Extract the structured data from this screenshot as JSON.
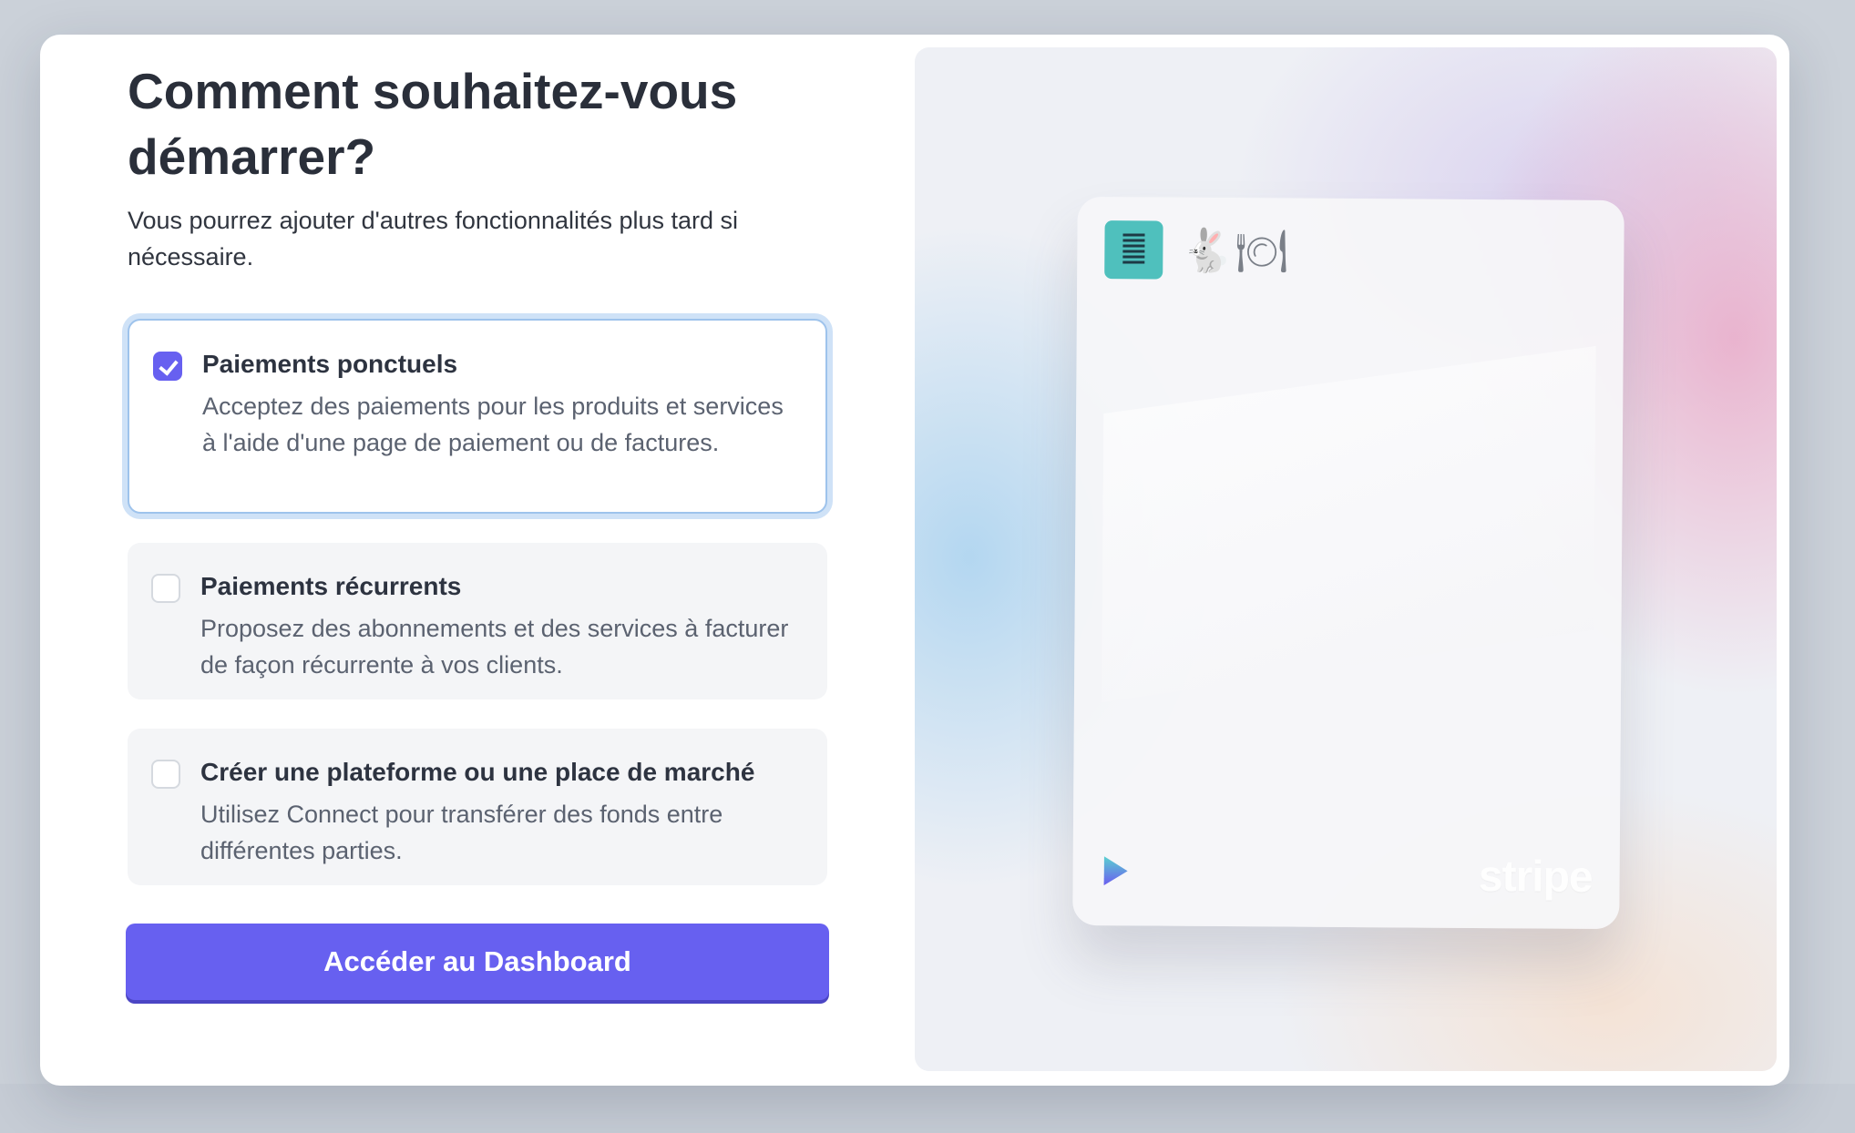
{
  "onboarding": {
    "heading": "Comment souhaitez-vous démarrer?",
    "subtitle": "Vous pourrez ajouter d'autres fonctionnalités plus tard si nécessaire.",
    "options": [
      {
        "title": "Paiements ponctuels",
        "description": "Acceptez des paiements pour les produits et services à l'aide d'une page de paiement ou de factures.",
        "checked": true
      },
      {
        "title": "Paiements récurrents",
        "description": "Proposez des abonnements et des services à facturer de façon récurrente à vos clients.",
        "checked": false
      },
      {
        "title": "Créer une plateforme ou une place de marché",
        "description": "Utilisez Connect pour transférer des fonds entre différentes parties.",
        "checked": false
      }
    ],
    "cta_label": "Accéder au Dashboard"
  },
  "illustration": {
    "emoji": "🐇🍽",
    "brand": "stripe",
    "icons": [
      "document-lines-icon",
      "rabbit-icon",
      "plate-icon",
      "play-logo-icon"
    ]
  },
  "colors": {
    "accent": "#6760f0",
    "selected_outline": "#9ec3ec",
    "icon_teal": "#4fc0bd"
  }
}
